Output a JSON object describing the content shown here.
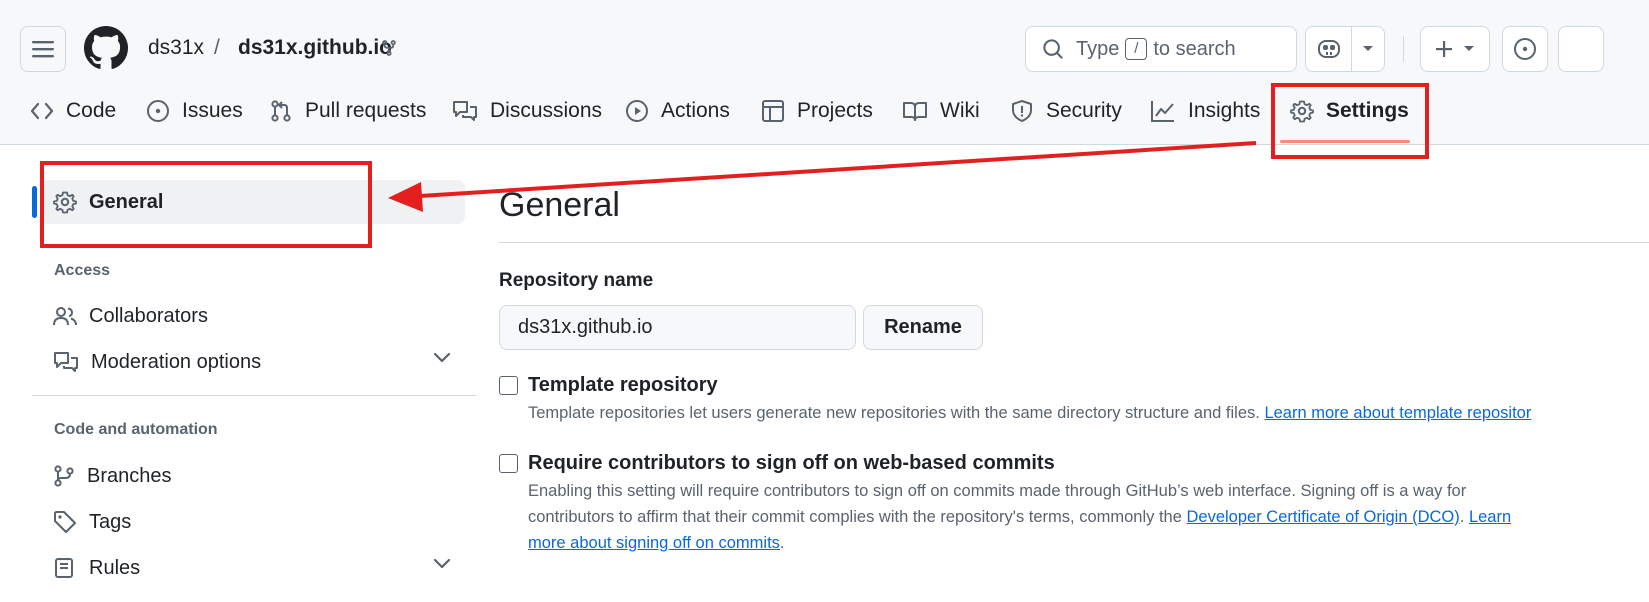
{
  "header": {
    "owner": "ds31x",
    "separator": "/",
    "repo": "ds31x.github.io",
    "search_placeholder_pre": "Type",
    "search_kbd": "/",
    "search_placeholder_post": "to search"
  },
  "tabs": [
    {
      "label": "Code",
      "icon": "code-icon"
    },
    {
      "label": "Issues",
      "icon": "issue-icon"
    },
    {
      "label": "Pull requests",
      "icon": "pull-request-icon"
    },
    {
      "label": "Discussions",
      "icon": "discussions-icon"
    },
    {
      "label": "Actions",
      "icon": "play-icon"
    },
    {
      "label": "Projects",
      "icon": "table-icon"
    },
    {
      "label": "Wiki",
      "icon": "book-icon"
    },
    {
      "label": "Security",
      "icon": "shield-icon"
    },
    {
      "label": "Insights",
      "icon": "graph-icon"
    },
    {
      "label": "Settings",
      "icon": "gear-icon",
      "active": true
    }
  ],
  "sidebar": {
    "general": "General",
    "access_heading": "Access",
    "collaborators": "Collaborators",
    "moderation": "Moderation options",
    "code_heading": "Code and automation",
    "branches": "Branches",
    "tags": "Tags",
    "rules": "Rules"
  },
  "main": {
    "title": "General",
    "repo_name_label": "Repository name",
    "repo_name_value": "ds31x.github.io",
    "rename_label": "Rename",
    "template": {
      "title": "Template repository",
      "desc": "Template repositories let users generate new repositories with the same directory structure and files.",
      "link": "Learn more about template repositor"
    },
    "signoff": {
      "title": "Require contributors to sign off on web-based commits",
      "desc_line1": "Enabling this setting will require contributors to sign off on commits made through GitHub’s web interface. Signing off is a way for",
      "desc_line2_pre": "contributors to affirm that their commit complies with the repository's terms, commonly the",
      "dco_link": "Developer Certificate of Origin (DCO)",
      "learn_link_part1": "Learn",
      "learn_link_part2": "more about signing off on commits",
      "period1": ".",
      "period2": "."
    }
  },
  "colors": {
    "annotation_red": "#e41f1f",
    "link_blue": "#0969da",
    "active_tab_underline": "#fd8c73",
    "active_bar": "#0969da"
  }
}
